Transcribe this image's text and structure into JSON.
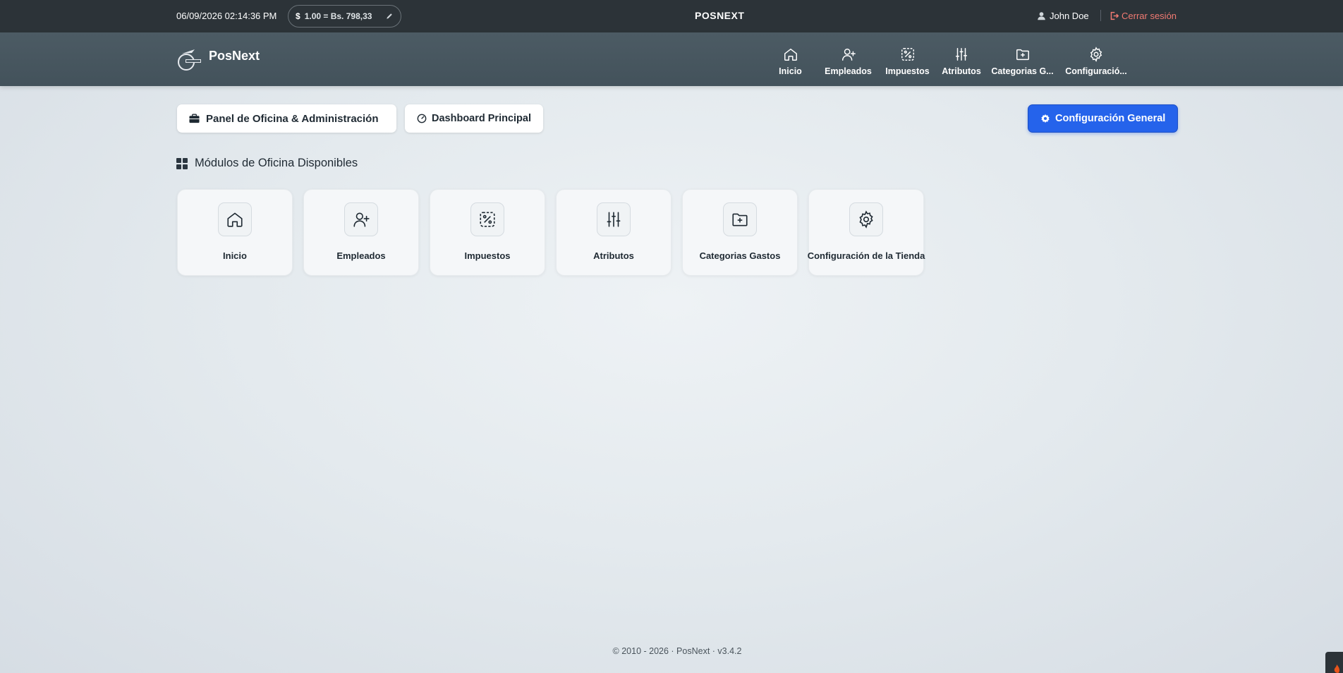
{
  "topbar": {
    "datetime": "06/09/2026 02:14:36 PM",
    "rate_currency": "$",
    "rate_text": "1.00 = Bs. 798,33",
    "center_title": "POSNEXT",
    "user_name": "John Doe",
    "logout_label": "Cerrar sesión"
  },
  "navbar": {
    "app_name": "PosNext",
    "items": [
      {
        "label": "Inicio",
        "icon": "home-icon"
      },
      {
        "label": "Empleados",
        "icon": "user-plus-icon"
      },
      {
        "label": "Impuestos",
        "icon": "tax-icon"
      },
      {
        "label": "Atributos",
        "icon": "sliders-icon"
      },
      {
        "label": "Categorias G...",
        "icon": "folder-plus-icon"
      },
      {
        "label": "Configuració...",
        "icon": "gear-icon"
      }
    ]
  },
  "actions": {
    "panel_label": "Panel de Oficina & Administración",
    "dashboard_label": "Dashboard Principal",
    "config_label": "Configuración General"
  },
  "modules": {
    "title": "Módulos de Oficina Disponibles",
    "cards": [
      {
        "label": "Inicio",
        "icon": "home-icon"
      },
      {
        "label": "Empleados",
        "icon": "user-plus-icon"
      },
      {
        "label": "Impuestos",
        "icon": "tax-icon"
      },
      {
        "label": "Atributos",
        "icon": "sliders-icon"
      },
      {
        "label": "Categorias Gastos",
        "icon": "folder-plus-icon"
      },
      {
        "label": "Configuración de la Tienda",
        "icon": "gear-icon"
      }
    ]
  },
  "footer": {
    "text": "© 2010 - 2026 · PosNext · v3.4.2"
  },
  "colors": {
    "primary": "#2563eb",
    "topbar": "#2c3338",
    "navbar": "#4c5b64",
    "logout": "#f07a72"
  }
}
